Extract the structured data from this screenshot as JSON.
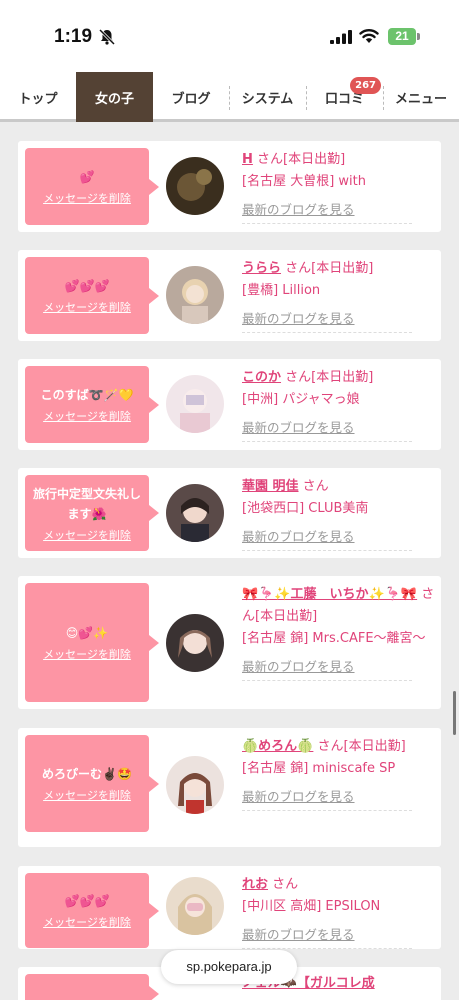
{
  "status_bar": {
    "time": "1:19",
    "battery": "21"
  },
  "tabs": [
    {
      "label": "トップ"
    },
    {
      "label": "女の子"
    },
    {
      "label": "ブログ"
    },
    {
      "label": "システム"
    },
    {
      "label": "口コミ",
      "badge": "267"
    },
    {
      "label": "メニュー"
    }
  ],
  "cards": [
    {
      "message": "💕",
      "delete": "メッセージを削除",
      "name": "H",
      "san": "さん[本日出勤]",
      "shop": "[名古屋 大曽根] with",
      "blog": "最新のブログを見る"
    },
    {
      "message": "💕💕💕",
      "delete": "メッセージを削除",
      "name": "うらら",
      "san": "さん[本日出勤]",
      "shop": "[豊橋] Lillion",
      "blog": "最新のブログを見る"
    },
    {
      "message": "このすば➰🪄💛",
      "delete": "メッセージを削除",
      "name": "このか",
      "san": "さん[本日出勤]",
      "shop": "[中洲] パジャマっ娘",
      "blog": "最新のブログを見る"
    },
    {
      "message": "旅行中定型文失礼します🌺",
      "delete": "メッセージを削除",
      "name": "華園 明佳",
      "san": "さん",
      "shop": "[池袋西口] CLUB美南",
      "blog": "最新のブログを見る"
    },
    {
      "message": "😊💕✨",
      "delete": "メッセージを削除",
      "name": "🎀🦩✨工藤　いちか✨🦩🎀",
      "san": "さん[本日出勤]",
      "shop": "[名古屋 錦] Mrs.CAFE～離宮～",
      "blog": "最新のブログを見る"
    },
    {
      "message": "めろぴーむ✌🏿🤩",
      "delete": "メッセージを削除",
      "name": "🍈めろん🍈",
      "san": "さん[本日出勤]",
      "shop": "[名古屋 錦] miniscafe SP",
      "blog": "最新のブログを見る"
    },
    {
      "message": "💕💕💕",
      "delete": "メッセージを削除",
      "name": "れお",
      "san": "さん",
      "shop": "[中川区 高畑] EPSILON",
      "blog": "最新のブログを見る"
    },
    {
      "message": "",
      "delete": "",
      "name": "ノェル🦇【ガルコレ成",
      "san": "",
      "shop": "",
      "blog": ""
    }
  ],
  "url_bar": "sp.pokepara.jp"
}
